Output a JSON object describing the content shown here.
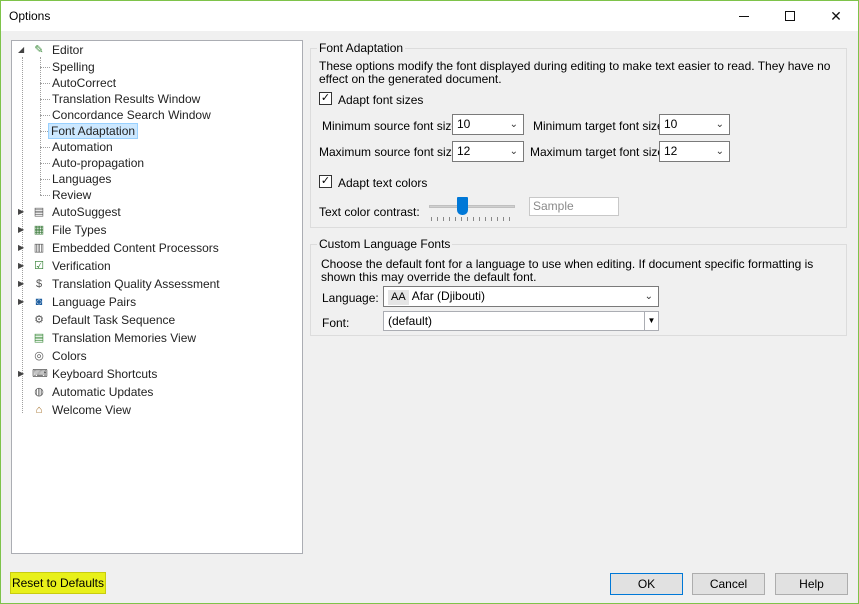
{
  "window": {
    "title": "Options"
  },
  "tree": {
    "editor": {
      "label": "Editor",
      "children": [
        "Spelling",
        "AutoCorrect",
        "Translation Results Window",
        "Concordance Search Window",
        "Font Adaptation",
        "Automation",
        "Auto-propagation",
        "Languages",
        "Review"
      ]
    },
    "items": [
      "AutoSuggest",
      "File Types",
      "Embedded Content Processors",
      "Verification",
      "Translation Quality Assessment",
      "Language Pairs",
      "Default Task Sequence",
      "Translation Memories View",
      "Colors",
      "Keyboard Shortcuts",
      "Automatic Updates",
      "Welcome View"
    ]
  },
  "font_adaptation": {
    "title": "Font Adaptation",
    "description": "These options modify the font displayed during editing to make text easier to read. They have no effect on the generated document.",
    "adapt_font_sizes_label": "Adapt font sizes",
    "adapt_font_sizes_checked": true,
    "min_source_label": "Minimum source font size:",
    "min_source_value": "10",
    "max_source_label": "Maximum source font size:",
    "max_source_value": "12",
    "min_target_label": "Minimum target font size:",
    "min_target_value": "10",
    "max_target_label": "Maximum target font size:",
    "max_target_value": "12",
    "adapt_colors_label": "Adapt text colors",
    "adapt_colors_checked": true,
    "contrast_label": "Text color contrast:",
    "contrast_level": 0.4,
    "sample_text": "Sample"
  },
  "custom_fonts": {
    "title": "Custom Language Fonts",
    "description": "Choose the default font for a language to use when editing. If document specific formatting is shown this may override the default font.",
    "language_label": "Language:",
    "language_badge": "AA",
    "language_value": "Afar (Djibouti)",
    "font_label": "Font:",
    "font_value": "(default)"
  },
  "buttons": {
    "reset": "Reset to Defaults",
    "ok": "OK",
    "cancel": "Cancel",
    "help": "Help"
  }
}
